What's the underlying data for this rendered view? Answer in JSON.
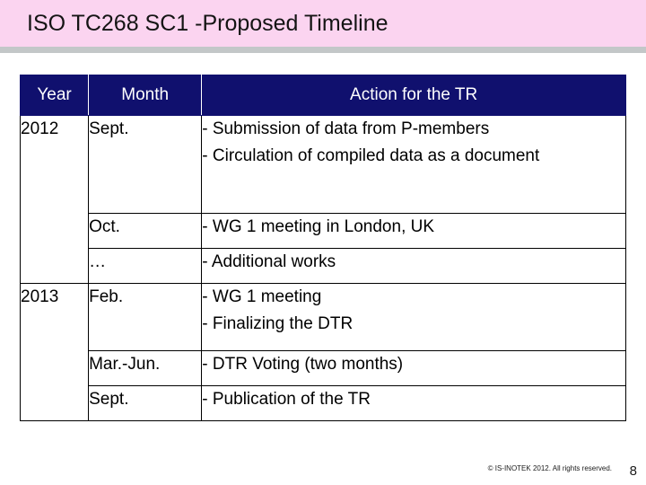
{
  "slide": {
    "title": "ISO TC268 SC1 -Proposed Timeline",
    "header_bg": "#fbd4f0",
    "rule_color": "#c3c7c8",
    "header_row_bg": "#10106e"
  },
  "table": {
    "headers": {
      "year": "Year",
      "month": "Month",
      "action": "Action for the TR"
    },
    "rows": [
      {
        "year": "2012",
        "month": "Sept.",
        "action_lines": [
          "- Submission of data from P-members",
          "- Circulation of compiled data as a document"
        ]
      },
      {
        "year": "",
        "month": "Oct.",
        "action_lines": [
          "- WG 1 meeting in London, UK"
        ]
      },
      {
        "year": "",
        "month": "…",
        "action_lines": [
          "- Additional works"
        ]
      },
      {
        "year": "2013",
        "month": "Feb.",
        "action_lines": [
          "- WG 1 meeting",
          "- Finalizing the DTR"
        ]
      },
      {
        "year": "",
        "month": "Mar.-Jun.",
        "action_lines": [
          "- DTR Voting (two months)"
        ]
      },
      {
        "year": "",
        "month": "Sept.",
        "action_lines": [
          "- Publication of the TR"
        ]
      }
    ]
  },
  "footer": {
    "copyright": "© IS-INOTEK 2012. All rights reserved.",
    "page_number": "8"
  }
}
